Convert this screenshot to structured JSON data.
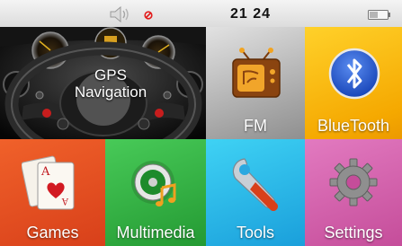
{
  "status": {
    "time": "21 24",
    "volume_icon": "speaker-icon",
    "mute_icon": "mute-icon",
    "battery_icon": "battery-icon"
  },
  "tiles": {
    "gps": {
      "title": "GPS",
      "subtitle": "Navigation",
      "icon": "steering-wheel-icon"
    },
    "fm": {
      "label": "FM",
      "icon": "radio-tv-icon"
    },
    "bluetooth": {
      "label": "BlueTooth",
      "icon": "bluetooth-icon"
    },
    "games": {
      "label": "Games",
      "icon": "playing-cards-icon"
    },
    "multimedia": {
      "label": "Multimedia",
      "icon": "media-disc-icon"
    },
    "tools": {
      "label": "Tools",
      "icon": "wrench-icon"
    },
    "settings": {
      "label": "Settings",
      "icon": "gear-icon"
    }
  },
  "colors": {
    "fm": "#a7a7a7",
    "bluetooth": "#f5a800",
    "games": "#d8401a",
    "multimedia": "#249a33",
    "tools": "#1a9fdb",
    "settings": "#c54d9a"
  }
}
